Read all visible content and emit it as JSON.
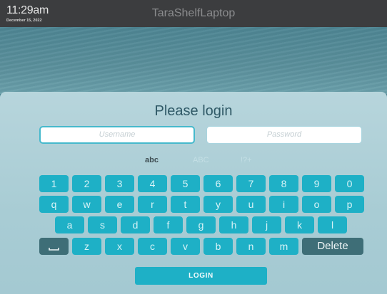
{
  "status_bar": {
    "time": "11:29am",
    "date": "December 15, 2022",
    "hostname": "TaraShelfLaptop"
  },
  "login_panel": {
    "title": "Please login",
    "username_placeholder": "Username",
    "password_placeholder": "Password",
    "modes": [
      "abc",
      "ABC",
      "!?+"
    ],
    "active_mode": "abc",
    "login_label": "LOGIN"
  },
  "keyboard": {
    "row1": [
      "1",
      "2",
      "3",
      "4",
      "5",
      "6",
      "7",
      "8",
      "9",
      "0"
    ],
    "row2": [
      "q",
      "w",
      "e",
      "r",
      "t",
      "y",
      "u",
      "i",
      "o",
      "p"
    ],
    "row3": [
      "a",
      "s",
      "d",
      "f",
      "g",
      "h",
      "j",
      "k",
      "l"
    ],
    "row4": [
      "z",
      "x",
      "c",
      "v",
      "b",
      "n",
      "m"
    ],
    "space_icon": "space-bar-icon",
    "delete_label": "Delete"
  },
  "colors": {
    "key": "#1eb0c6",
    "key_dark": "#3e6e77",
    "topbar": "#3c3d3f",
    "title": "#2f5966"
  }
}
